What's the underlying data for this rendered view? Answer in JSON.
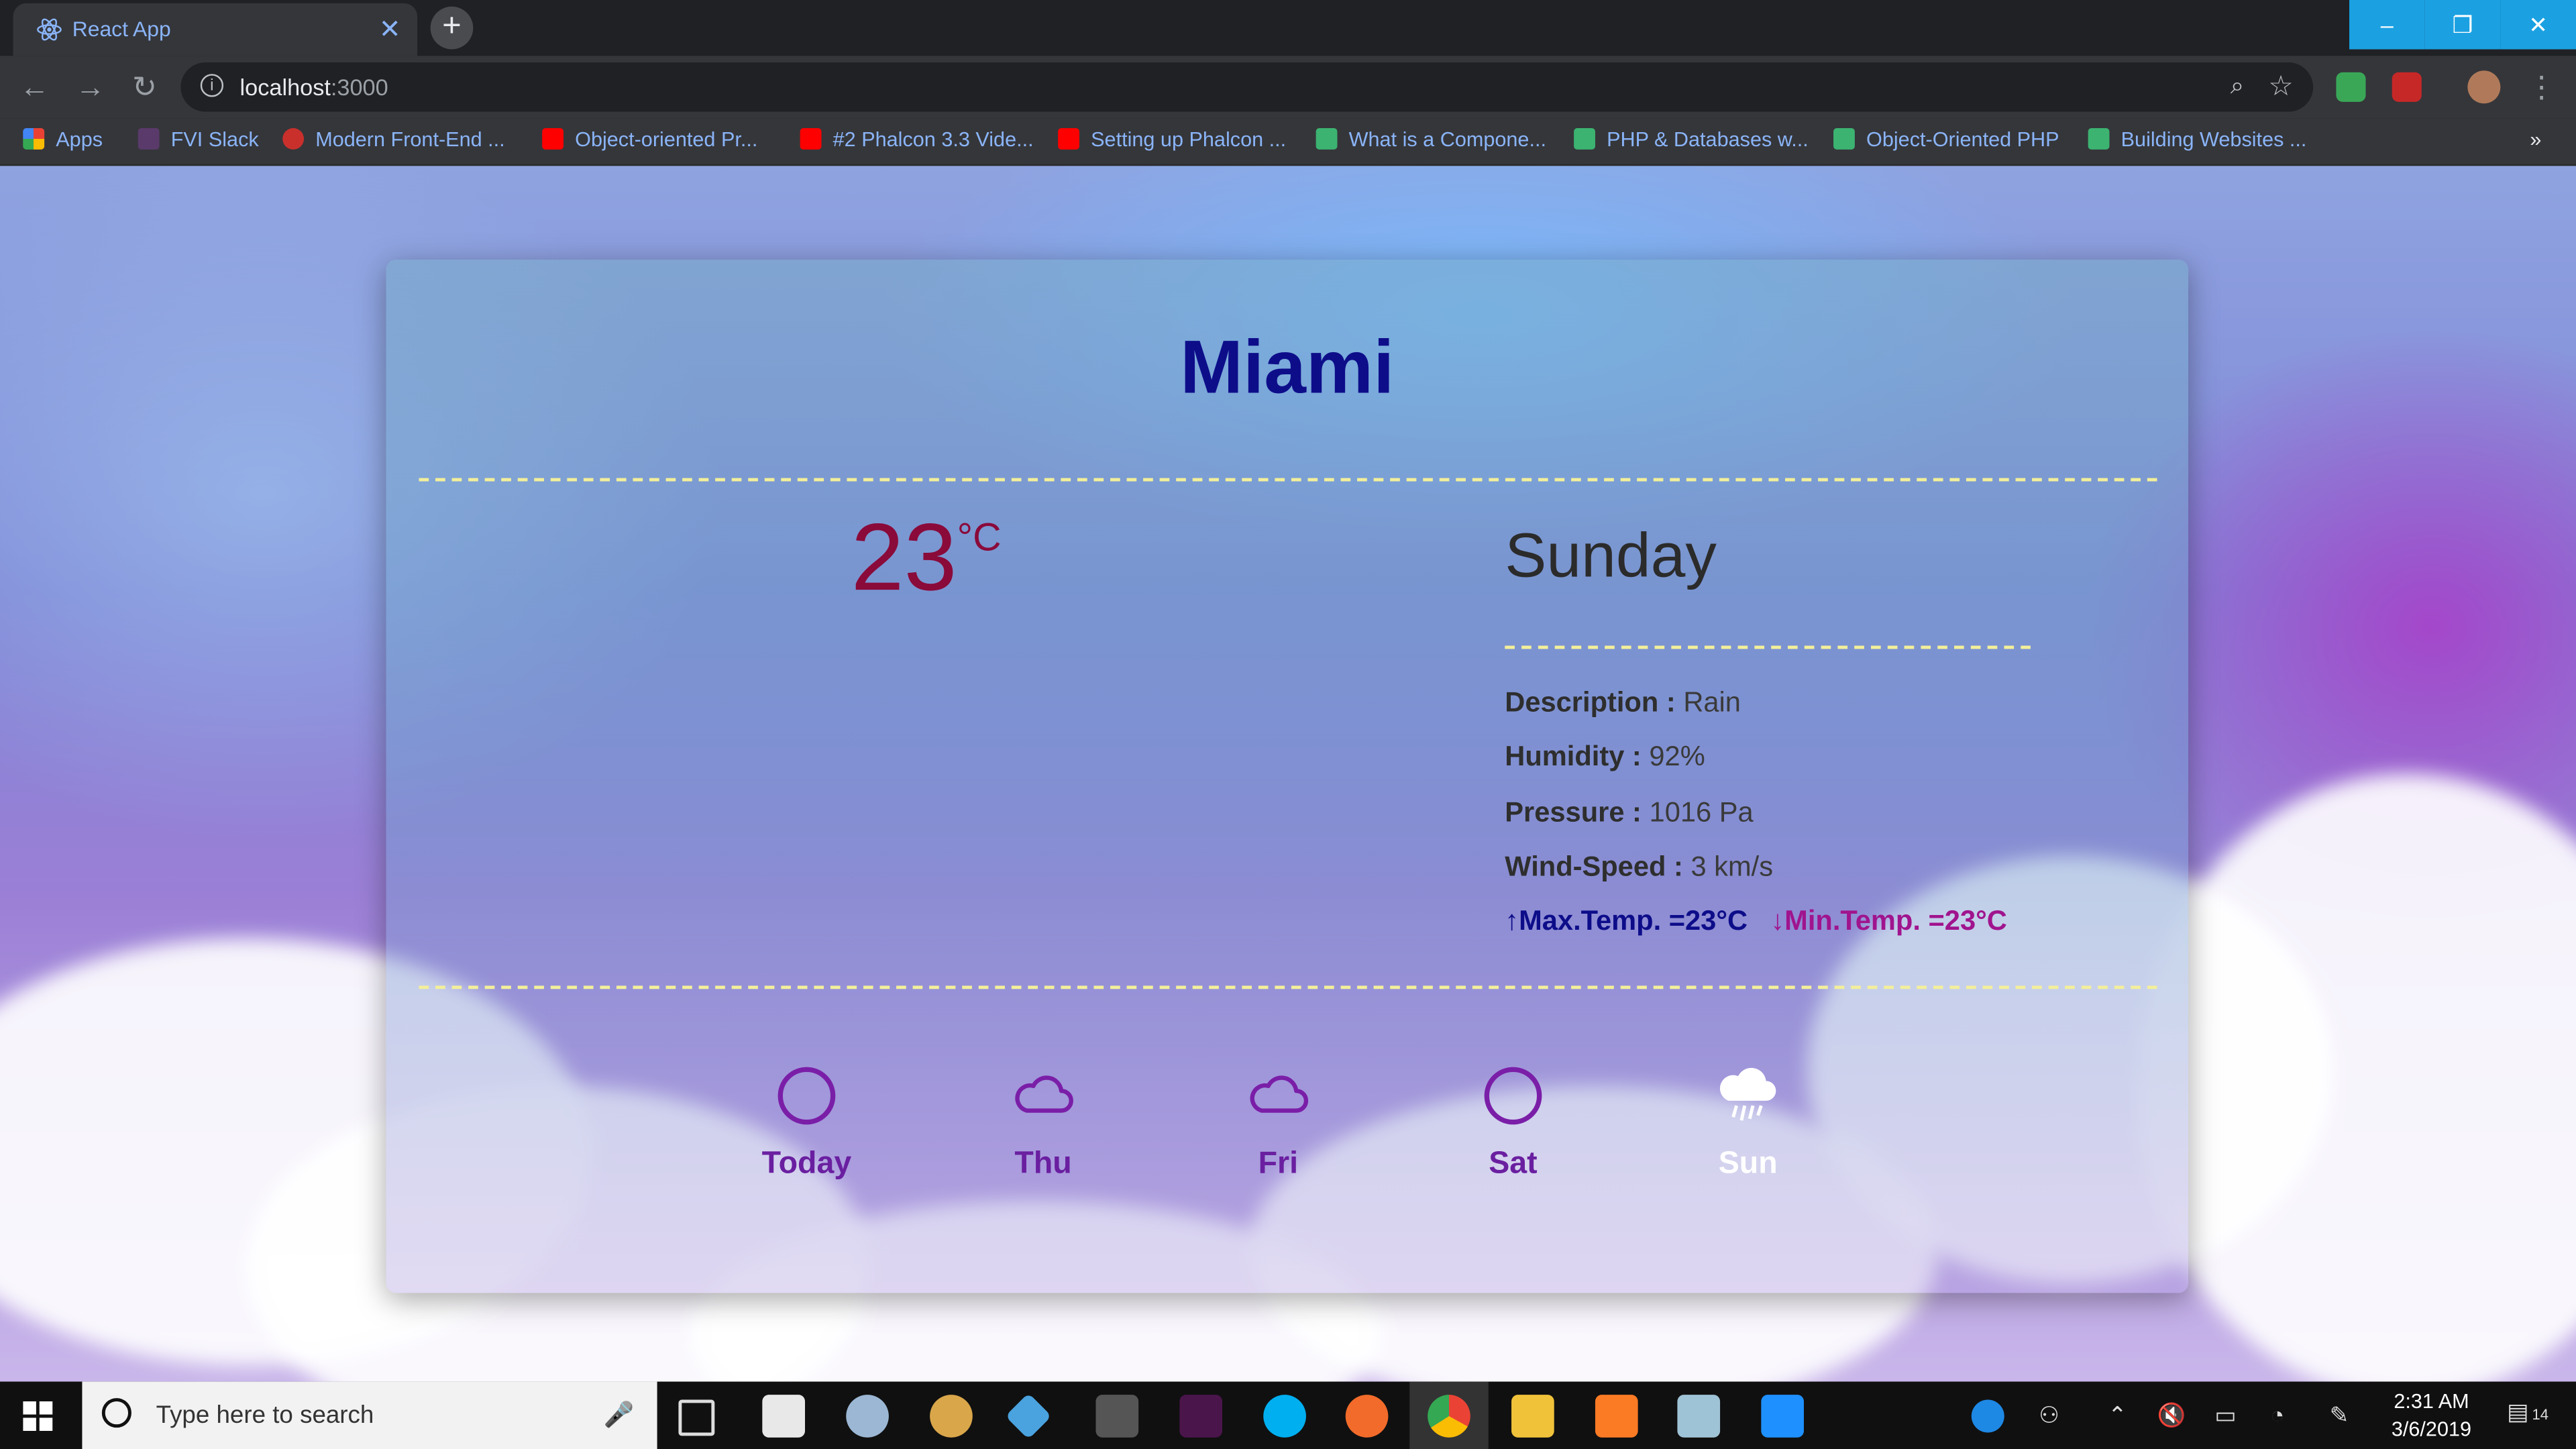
{
  "browser": {
    "tab_title": "React App",
    "tab_close": "✕",
    "new_tab": "+",
    "url_host": "localhost",
    "url_port": ":3000",
    "window_controls": [
      "–",
      "❐",
      "✕"
    ],
    "bookmarks": [
      {
        "label": "Apps",
        "color": "#e94235"
      },
      {
        "label": "FVI Slack",
        "color": "#5a3a6b"
      },
      {
        "label": "Modern Front-End ...",
        "color": "#c9302c"
      },
      {
        "label": "Object-oriented Pr...",
        "color": "#ff0000"
      },
      {
        "label": "#2 Phalcon 3.3 Vide...",
        "color": "#ff0000"
      },
      {
        "label": "Setting up Phalcon ...",
        "color": "#ff0000"
      },
      {
        "label": "What is a Compone...",
        "color": "#3cb371"
      },
      {
        "label": "PHP & Databases w...",
        "color": "#3cb371"
      },
      {
        "label": "Object-Oriented PHP",
        "color": "#3cb371"
      },
      {
        "label": "Building Websites ...",
        "color": "#3cb371"
      }
    ],
    "bookmarks_more": "»"
  },
  "weather": {
    "city": "Miami",
    "temp": "23",
    "temp_unit": "°C",
    "day": "Sunday",
    "details": [
      {
        "label": "Description :",
        "value": "Rain"
      },
      {
        "label": "Humidity :",
        "value": "92%"
      },
      {
        "label": "Pressure :",
        "value": "1016 Pa"
      },
      {
        "label": "Wind-Speed :",
        "value": "3 km/s"
      }
    ],
    "max_temp": "↑Max.Temp. =23°C",
    "min_temp": "↓Min.Temp. =23°C",
    "forecast": [
      {
        "label": "Today",
        "icon": "circle-icon"
      },
      {
        "label": "Thu",
        "icon": "cloud-icon"
      },
      {
        "label": "Fri",
        "icon": "cloud-icon"
      },
      {
        "label": "Sat",
        "icon": "circle-icon"
      },
      {
        "label": "Sun",
        "icon": "rain-cloud-icon"
      }
    ]
  },
  "taskbar": {
    "search_placeholder": "Type here to search",
    "time": "2:31 AM",
    "date": "3/6/2019",
    "notifications": "14"
  },
  "colors": {
    "city": "#0d0d8a",
    "temp": "#8a0a3a",
    "max": "#0d0d8a",
    "min": "#a0148e",
    "forecast_label": "#6a1fa0",
    "divider": "#f3ef9a"
  }
}
